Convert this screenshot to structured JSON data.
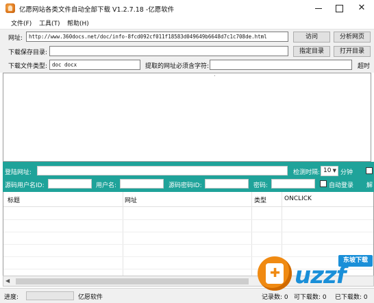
{
  "window": {
    "title": "亿愿网站各类文件自动全部下载 V1.2.7.18 -亿愿软件",
    "close_glyph": "✕"
  },
  "menu": [
    "文件(F)",
    "工具(T)",
    "帮助(H)"
  ],
  "form": {
    "url_label": "网址:",
    "url_value": "http://www.360docs.net/doc/info-8fcd092cf011f18583d049649b6648d7c1c708de.html",
    "visit_button": "访问",
    "analyze_button": "分析网页",
    "save_dir_label": "下载保存目录:",
    "save_dir_value": "",
    "choose_dir_button": "指定目录",
    "open_dir_button": "打开目录",
    "file_type_label": "下载文件类型:",
    "file_type_value": "doc docx",
    "required_chars_label": "提取的网址必须含字符:",
    "required_chars_value": "",
    "truncated_label": "超时"
  },
  "login": {
    "login_url_label": "登陆网址:",
    "interval_label": "检测时隔:",
    "interval_value": "10",
    "interval_unit": "分钟",
    "username_id_label": "源码用户名ID:",
    "username_label": "用户名:",
    "password_id_label": "源码密码ID:",
    "password_label": "密码:",
    "auto_login_label": "自动登录",
    "truncated_label": "解"
  },
  "table": {
    "columns": [
      "标题",
      "网址",
      "类型",
      "ONCLICK"
    ]
  },
  "status": {
    "progress_label": "进度:",
    "progress": 0,
    "company": "亿愿软件",
    "record_count": "记录数: 0",
    "downloadable": "可下载数: 0",
    "downloaded": "已下载数: 0",
    "progress_color": "#06b025"
  },
  "watermark": {
    "text": "uzzf",
    "badge": "东坡下载",
    "brand_color": "#1a8fd8",
    "accent_color": "#f08a12"
  },
  "accent": {
    "teal": "#1fa39a"
  }
}
